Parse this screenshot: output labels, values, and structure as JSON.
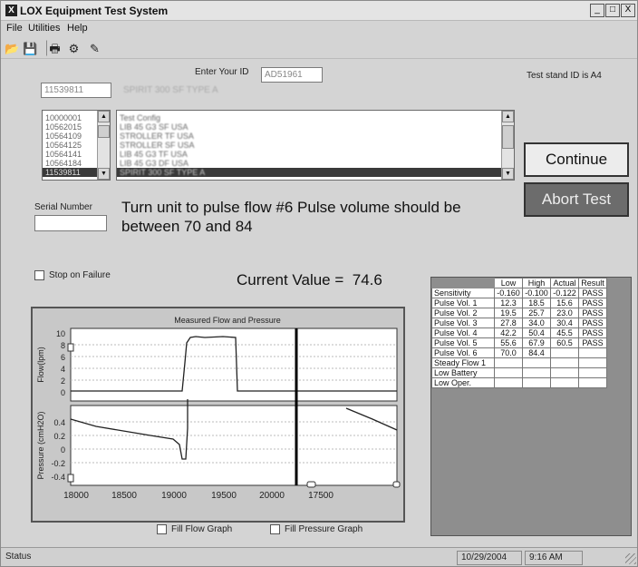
{
  "window": {
    "app_icon": "X",
    "title": "LOX Equipment Test System",
    "minimize": "_",
    "maximize": "□",
    "close": "X"
  },
  "menu": [
    "File",
    "Utilities",
    "Help"
  ],
  "toolbar": {
    "icons": [
      "open-folder-icon",
      "save-icon",
      "print-icon",
      "tools-icon",
      "edit-icon"
    ],
    "glyphs": [
      "📂",
      "💾",
      "🖶",
      "⚙",
      "✎"
    ]
  },
  "header": {
    "enter_id_label": "Enter Your ID",
    "user_id": "AD51961",
    "test_stand": "Test stand ID is A4",
    "part_number": "11539811",
    "part_desc": "SPIRIT 300 SF TYPE A"
  },
  "part_list": [
    "10000001",
    "10562015",
    "10564109",
    "10564125",
    "10564141",
    "10564184",
    "11539811"
  ],
  "desc_list": [
    "Test Config",
    "LIB 45 G3 SF USA",
    "STROLLER TF USA",
    "STROLLER SF USA",
    "LIB 45 G3 TF USA",
    "LIB 45 G3 DF USA",
    "SPIRIT 300 SF TYPE A"
  ],
  "serial": {
    "label": "Serial Number",
    "value": ""
  },
  "instruction": "Turn unit to pulse flow #6 Pulse volume should be between 70 and 84",
  "buttons": {
    "continue": "Continue",
    "abort": "Abort Test"
  },
  "stop_on_failure": "Stop on Failure",
  "current_value": {
    "label": "Current Value =",
    "value": "74.6"
  },
  "graph": {
    "title": "Measured Flow and Pressure",
    "flow_axis_label": "Flow(lpm)",
    "pressure_axis_label": "Pressure (cmH2O)",
    "flow_ticks": [
      "10",
      "8",
      "6",
      "4",
      "2",
      "0"
    ],
    "pressure_ticks": [
      "0.4",
      "0.2",
      "0",
      "-0.2",
      "-0.4"
    ],
    "x_ticks": [
      "18000",
      "18500",
      "19000",
      "19500",
      "20000",
      "17500"
    ],
    "fill_flow": "Fill Flow Graph",
    "fill_pressure": "Fill Pressure Graph"
  },
  "results": {
    "headers": [
      "",
      "Low",
      "High",
      "Actual",
      "Result"
    ],
    "rows": [
      [
        "Sensitivity",
        "-0.160",
        "-0.100",
        "-0.122",
        "PASS"
      ],
      [
        "Pulse Vol. 1",
        "12.3",
        "18.5",
        "15.6",
        "PASS"
      ],
      [
        "Pulse Vol. 2",
        "19.5",
        "25.7",
        "23.0",
        "PASS"
      ],
      [
        "Pulse Vol. 3",
        "27.8",
        "34.0",
        "30.4",
        "PASS"
      ],
      [
        "Pulse Vol. 4",
        "42.2",
        "50.4",
        "45.5",
        "PASS"
      ],
      [
        "Pulse Vol. 5",
        "55.6",
        "67.9",
        "60.5",
        "PASS"
      ],
      [
        "Pulse Vol. 6",
        "70.0",
        "84.4",
        "",
        ""
      ],
      [
        "Steady Flow 1",
        "",
        "",
        "",
        ""
      ],
      [
        "Low Battery",
        "",
        "",
        "",
        ""
      ],
      [
        "Low Oper.",
        "",
        "",
        "",
        ""
      ]
    ]
  },
  "status": {
    "text": "Status",
    "date": "10/29/2004",
    "time": "9:16 AM"
  },
  "colors": {
    "window_bg": "#d4d4d4",
    "selected_row": "#3a3a3a",
    "abort_button": "#6c6c6c"
  }
}
